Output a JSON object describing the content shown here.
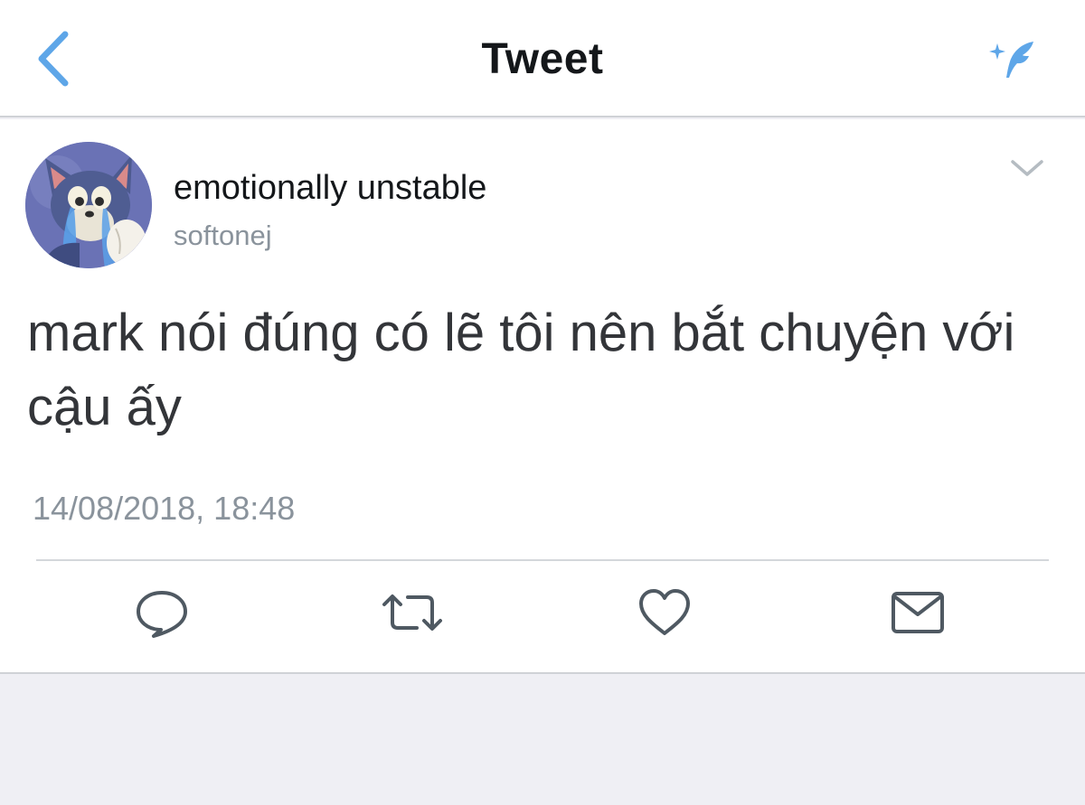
{
  "nav": {
    "title": "Tweet",
    "back_icon": "chevron-left-icon",
    "compose_icon": "compose-tweet-icon",
    "accent_color": "#5ea6e8"
  },
  "tweet": {
    "author": {
      "display_name": "emotionally unstable",
      "handle": "softonej",
      "avatar_icon": "cartoon-cat-crying-avatar"
    },
    "text": "mark nói đúng có lẽ tôi nên bắt chuyện với cậu ấy",
    "timestamp": "14/08/2018, 18:48",
    "menu_icon": "chevron-down-icon"
  },
  "actions": [
    {
      "name": "reply",
      "icon": "reply-icon"
    },
    {
      "name": "retweet",
      "icon": "retweet-icon"
    },
    {
      "name": "like",
      "icon": "heart-icon"
    },
    {
      "name": "direct-message",
      "icon": "envelope-icon"
    }
  ],
  "colors": {
    "text_primary": "#14171a",
    "text_secondary": "#8a939c",
    "action_icon": "#4f5962",
    "background": "#efeff4"
  }
}
